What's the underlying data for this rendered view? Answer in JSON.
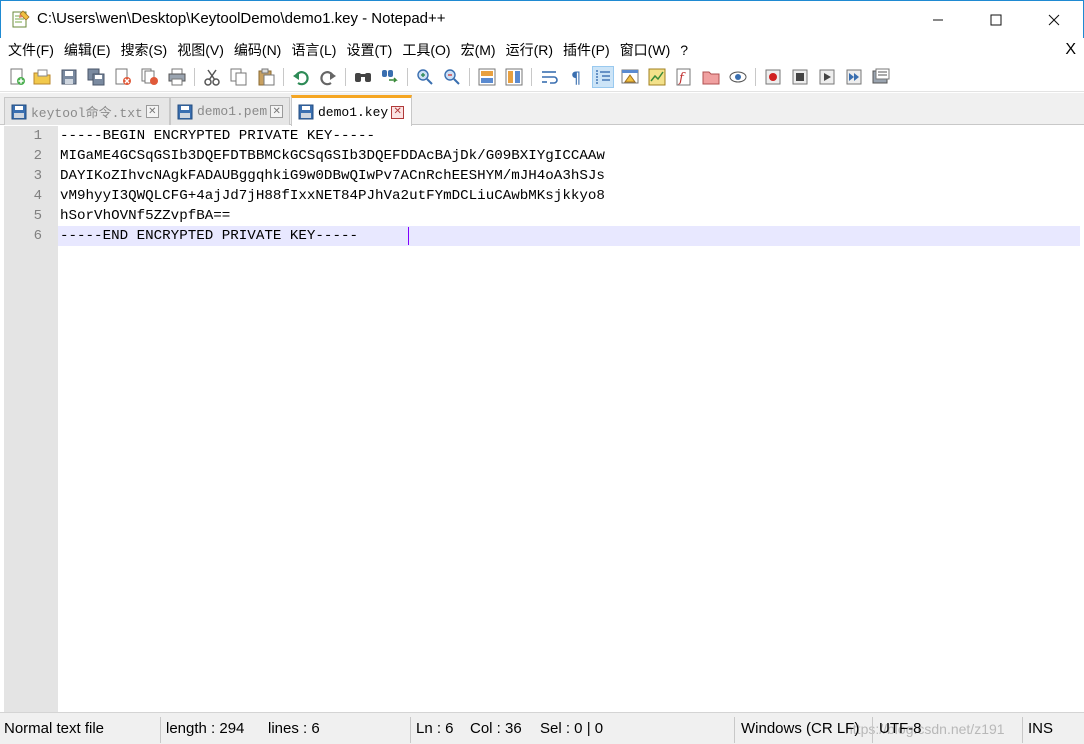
{
  "window": {
    "title": "C:\\Users\\wen\\Desktop\\KeytoolDemo\\demo1.key - Notepad++",
    "minimize_glyph": "—",
    "maximize_glyph": "☐",
    "close_glyph": "✕"
  },
  "menu": {
    "items": [
      "文件(F)",
      "编辑(E)",
      "搜索(S)",
      "视图(V)",
      "编码(N)",
      "语言(L)",
      "设置(T)",
      "工具(O)",
      "宏(M)",
      "运行(R)",
      "插件(P)",
      "窗口(W)",
      "?"
    ],
    "close_label": "X"
  },
  "toolbar": {
    "buttons": [
      "new-file-icon",
      "open-file-icon",
      "save-icon",
      "save-all-icon",
      "close-icon",
      "close-all-icon",
      "print-icon",
      "cut-icon",
      "copy-icon",
      "paste-icon",
      "undo-icon",
      "redo-icon",
      "find-icon",
      "replace-icon",
      "zoom-in-icon",
      "zoom-out-icon",
      "sync-vertical-icon",
      "sync-horizontal-icon",
      "word-wrap-icon",
      "show-all-chars-icon",
      "indent-guide-icon",
      "user-lang-icon",
      "doc-map-icon",
      "function-list-icon",
      "folder-workspace-icon",
      "monitoring-icon",
      "record-macro-icon",
      "stop-macro-icon",
      "play-macro-icon",
      "run-macro-multiple-icon",
      "save-macro-icon"
    ]
  },
  "tabs": [
    {
      "label": "keytool命令.txt",
      "close": "✕",
      "active": false
    },
    {
      "label": "demo1.pem",
      "close": "✕",
      "active": false
    },
    {
      "label": "demo1.key",
      "close": "✕",
      "active": true
    }
  ],
  "editor": {
    "lines": [
      {
        "num": "1",
        "text": "-----BEGIN ENCRYPTED PRIVATE KEY-----"
      },
      {
        "num": "2",
        "text": "MIGaME4GCSqGSIb3DQEFDTBBMCkGCSqGSIb3DQEFDDAcBAjDk/G09BXIYgICCAAw"
      },
      {
        "num": "3",
        "text": "DAYIKoZIhvcNAgkFADAUBggqhkiG9w0DBwQIwPv7ACnRchEESHYM/mJH4oA3hSJs"
      },
      {
        "num": "4",
        "text": "vM9hyyI3QWQLCFG+4ajJd7jH88fIxxNET84PJhVa2utFYmDCLiuCAwbMKsjkkyo8"
      },
      {
        "num": "5",
        "text": "hSorVhOVNf5ZZvpfBA=="
      },
      {
        "num": "6",
        "text": "-----END ENCRYPTED PRIVATE KEY-----"
      }
    ]
  },
  "status": {
    "file_type": "Normal text file",
    "length": "length : 294",
    "lines": "lines : 6",
    "ln": "Ln : 6",
    "col": "Col : 36",
    "sel": "Sel : 0 | 0",
    "eol": "Windows (CR LF)",
    "encoding": "UTF-8",
    "mode": "INS",
    "watermark": "https://blog.csdn.net/z191"
  },
  "colors": {
    "current_line": "#e8e8ff",
    "caret": "#8000ff",
    "active_tab_accent": "#f5a623",
    "gutter": "#e4e4e4"
  }
}
